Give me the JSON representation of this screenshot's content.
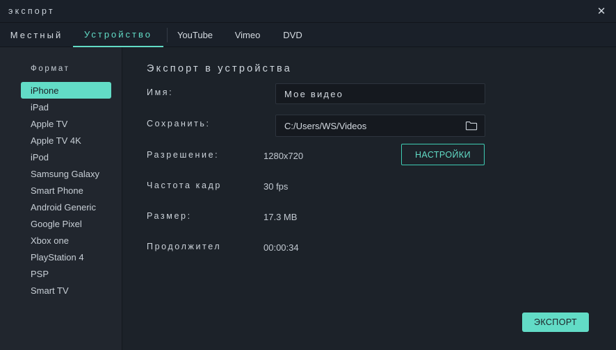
{
  "window": {
    "title": "экспорт",
    "close_icon": "close-icon"
  },
  "tabs": [
    {
      "label": "Местный",
      "active": false
    },
    {
      "label": "Устройство",
      "active": true
    },
    {
      "label": "YouTube",
      "active": false
    },
    {
      "label": "Vimeo",
      "active": false
    },
    {
      "label": "DVD",
      "active": false
    }
  ],
  "sidebar": {
    "title": "Формат",
    "items": [
      {
        "label": "iPhone",
        "selected": true
      },
      {
        "label": "iPad",
        "selected": false
      },
      {
        "label": "Apple TV",
        "selected": false
      },
      {
        "label": "Apple TV 4K",
        "selected": false
      },
      {
        "label": "iPod",
        "selected": false
      },
      {
        "label": "Samsung Galaxy",
        "selected": false
      },
      {
        "label": "Smart Phone",
        "selected": false
      },
      {
        "label": "Android Generic",
        "selected": false
      },
      {
        "label": "Google Pixel",
        "selected": false
      },
      {
        "label": "Xbox one",
        "selected": false
      },
      {
        "label": "PlayStation 4",
        "selected": false
      },
      {
        "label": "PSP",
        "selected": false
      },
      {
        "label": "Smart TV",
        "selected": false
      }
    ]
  },
  "main": {
    "heading": "Экспорт в устройства",
    "name": {
      "label": "Имя:",
      "value": "Мое видео",
      "placeholder": "Мое видео"
    },
    "save": {
      "label": "Сохранить:",
      "value": "C:/Users/WS/Videos",
      "placeholder": "C:/Users/WS/Videos",
      "browse_icon": "folder-icon"
    },
    "resolution": {
      "label": "Разрешение:",
      "value": "1280x720",
      "settings_button": "НАСТРОЙКИ"
    },
    "framerate": {
      "label": "Частота кадр",
      "value": "30 fps"
    },
    "size": {
      "label": "Размер:",
      "value": "17.3 MB"
    },
    "duration": {
      "label": "Продолжител",
      "value": "00:00:34"
    },
    "export_button": "ЭКСПОРТ"
  },
  "colors": {
    "accent": "#62dcc6",
    "window_bg": "#1c2229",
    "sidebar_bg": "#21262e",
    "titlebar_bg": "#1a2029",
    "field_bg": "#15191f"
  }
}
